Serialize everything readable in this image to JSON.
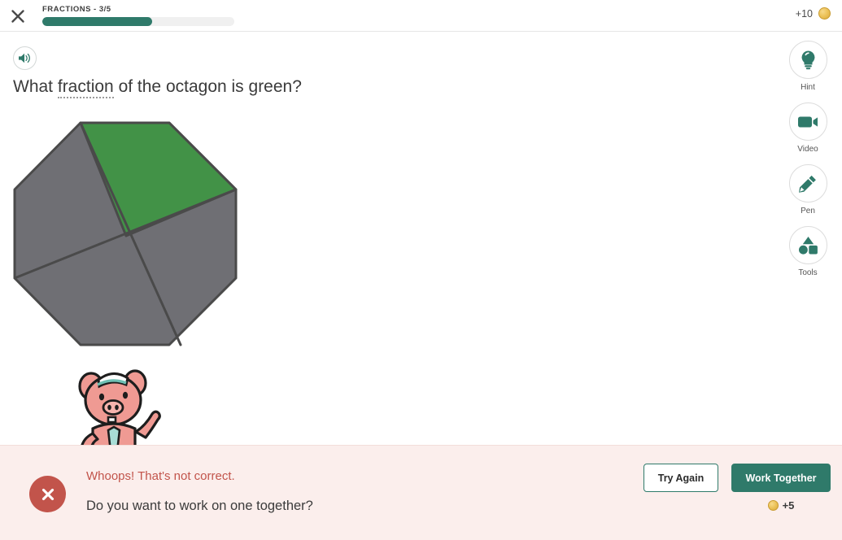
{
  "header": {
    "close_icon": "close-icon",
    "lesson_title": "FRACTIONS - 3/5",
    "progress_percent": 57,
    "points_label": "+10",
    "coin_icon": "coin-icon"
  },
  "question": {
    "speaker_icon": "speaker-icon",
    "prefix": "What ",
    "term": "fraction",
    "suffix": " of the octagon is green?"
  },
  "shape": {
    "name": "octagon",
    "total_parts": 4,
    "shaded_parts": 1,
    "shaded_color": "#429247",
    "unshaded_color": "#6f6f74",
    "stroke_color": "#4a4a4a"
  },
  "mascot": {
    "name": "pig-mascot",
    "body_color": "#ef9a93",
    "hat_color": "#ffffff",
    "tie_color": "#6fbfb3"
  },
  "toolbar": {
    "items": [
      {
        "label": "Hint",
        "icon": "lightbulb-icon"
      },
      {
        "label": "Video",
        "icon": "video-camera-icon"
      },
      {
        "label": "Pen",
        "icon": "pencil-icon"
      },
      {
        "label": "Tools",
        "icon": "shapes-icon"
      }
    ]
  },
  "feedback": {
    "status_icon": "error-x-icon",
    "headline": "Whoops! That's not correct.",
    "subtext": "Do you want to work on one together?",
    "try_again_label": "Try Again",
    "work_together_label": "Work Together",
    "reward_label": "+5",
    "reward_coin_icon": "coin-icon",
    "accent_color": "#c2544b",
    "background_color": "#fbeeec"
  },
  "theme": {
    "brand_color": "#2f7a6a",
    "error_color": "#c2544b",
    "coin_color": "#edc45c"
  }
}
